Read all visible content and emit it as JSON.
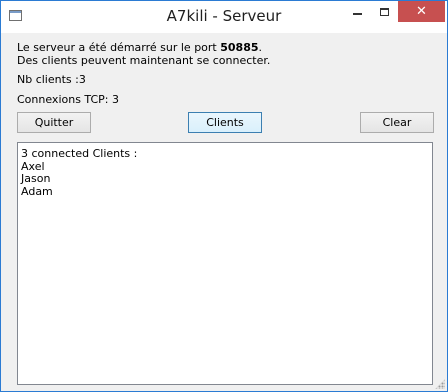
{
  "window": {
    "title": "A7kili - Serveur",
    "close_glyph": "✕"
  },
  "info": {
    "line1_prefix": "Le serveur a été démarré sur le port ",
    "port": "50885",
    "line1_suffix": ".",
    "line2": "Des clients peuvent maintenant se connecter.",
    "nb_clients": "Nb clients :3",
    "tcp_connections": "Connexions TCP: 3"
  },
  "buttons": {
    "quit": "Quitter",
    "clients": "Clients",
    "clear": "Clear"
  },
  "log": {
    "lines": [
      "3 connected Clients :",
      "Axel",
      "Jason",
      "Adam"
    ]
  },
  "icons": [
    "app-icon",
    "minimize-icon",
    "maximize-icon",
    "close-icon",
    "resize-grip-icon"
  ],
  "colors": {
    "close_button": "#c75050",
    "window_border": "#2b7bd3"
  }
}
